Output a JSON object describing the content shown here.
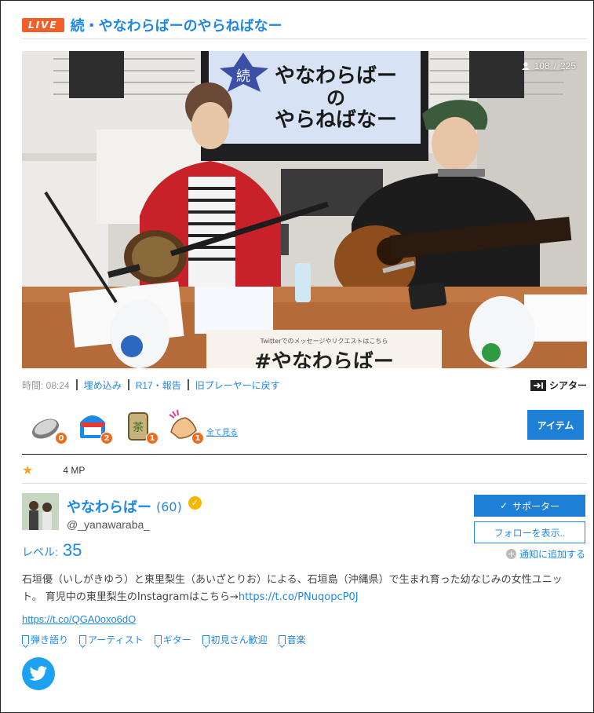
{
  "header": {
    "live_label": "LIVE",
    "title": "続・やなわらばーのやらねばなー"
  },
  "video": {
    "viewers": "108",
    "viewers_total": "225",
    "screen_text_line1": "やなわらばー",
    "screen_text_line2": "の",
    "screen_text_line3": "やらねばなー",
    "screen_badge": "続",
    "poster_small": "Twitterでのメッセージやリクエストはこちら",
    "poster_big": "#やなわらばー"
  },
  "meta": {
    "time": "時間: 08:24",
    "embed": "埋め込み",
    "report": "R17・報告",
    "old_player": "旧プレーヤーに戻す",
    "theater": "シアター"
  },
  "gifts": [
    {
      "name": "coin",
      "count": "0"
    },
    {
      "name": "shop",
      "count": "2"
    },
    {
      "name": "tea",
      "count": "1"
    },
    {
      "name": "clap",
      "count": "1"
    }
  ],
  "gift_tea_char": "茶",
  "see_all": "全て見る",
  "item_button": "アイテム",
  "mp": "4 MP",
  "profile": {
    "name": "やなわらばー",
    "age": "(60)",
    "handle": "@_yanawaraba_",
    "level_label": "レベル:",
    "level": "35",
    "supporter": "サポーター",
    "follow": "フォローを表示..",
    "notify": "通知に追加する",
    "bio_text": "石垣優（いしがきゆう）と東里梨生（あいざとりお）による、石垣島（沖縄県）で生まれ育った幼なじみの女性ユニット。 育児中の東里梨生のInstagramはこちら→",
    "bio_link": "https://t.co/PNuqopcP0J",
    "link": "https://t.co/QGA0oxo6dO"
  },
  "tags": [
    "弾き語り",
    "アーティスト",
    "ギター",
    "初見さん歓迎",
    "音楽"
  ],
  "colors": {
    "accent": "#1e88e5",
    "live": "#f0602a",
    "badge": "#f26a1b",
    "twitter": "#1da1f2"
  }
}
